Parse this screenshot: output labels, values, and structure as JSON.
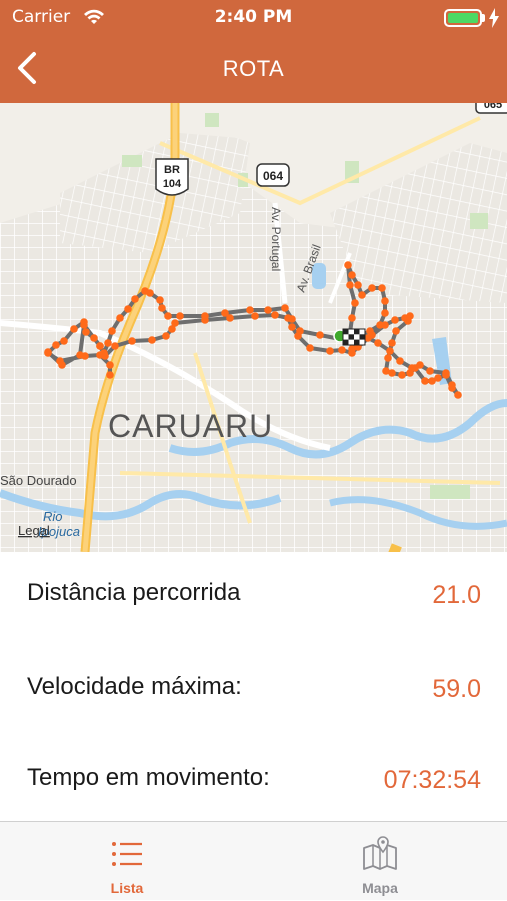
{
  "status_bar": {
    "carrier": "Carrier",
    "time": "2:40 PM"
  },
  "nav": {
    "title": "ROTA",
    "back_icon": "chevron-left-icon"
  },
  "map": {
    "city_label": "CARUARU",
    "route_color": "#ff6a1a",
    "labels": {
      "br": "BR",
      "br_num": "104",
      "shield_064": "064",
      "shield_corner": "065",
      "av_portugal": "Av. Portugal",
      "av_brasil": "Av. Brasil",
      "sao_dourado": "São Dourado",
      "rio": "Rio",
      "ipojuca": "Ipojuca",
      "legal": "Legal"
    }
  },
  "stats": [
    {
      "label": "Distância percorrida",
      "value": "21.0"
    },
    {
      "label": "Velocidade máxima:",
      "value": "59.0"
    },
    {
      "label": "Tempo em movimento:",
      "value": "07:32:54"
    }
  ],
  "tabs": [
    {
      "label": "Lista",
      "icon": "list-icon",
      "active": true
    },
    {
      "label": "Mapa",
      "icon": "map-icon",
      "active": false
    }
  ],
  "colors": {
    "header": "#d0683d",
    "accent": "#e2683a",
    "inactive_tab": "#8e8e93"
  }
}
